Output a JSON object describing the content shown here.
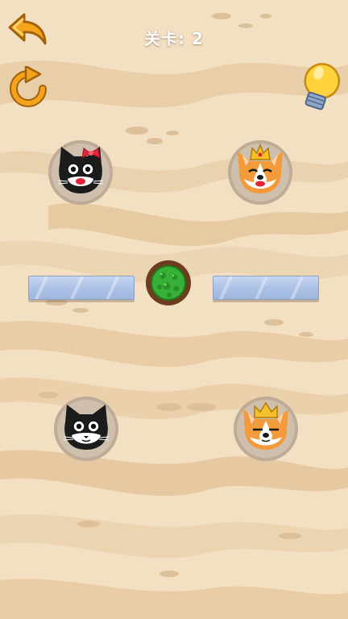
{
  "header": {
    "level_label": "关卡: 2",
    "back_icon": "back-arrow-icon",
    "restart_icon": "restart-icon",
    "hint_icon": "lightbulb-icon"
  },
  "board": {
    "characters": [
      {
        "name": "female-black-cat",
        "features": [
          "red-bow",
          "red-lips"
        ]
      },
      {
        "name": "queen-corgi",
        "features": [
          "crown",
          "red-lips"
        ]
      },
      {
        "name": "black-cat",
        "features": []
      },
      {
        "name": "king-corgi",
        "features": [
          "crown"
        ]
      }
    ],
    "barriers": [
      "glass-barrier-left",
      "glass-barrier-right"
    ],
    "ball": "green-virus-ball"
  },
  "colors": {
    "accent_orange": "#f5a31a",
    "sand": "#f3dfc2",
    "glass": "#aec3e6",
    "ball_green": "#3cb43c"
  }
}
